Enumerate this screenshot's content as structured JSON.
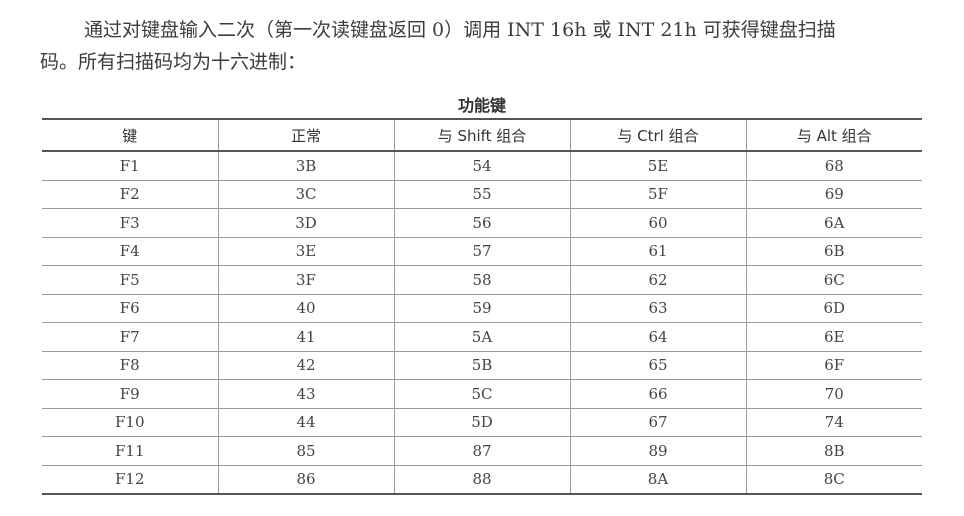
{
  "intro": {
    "line1": "通过对键盘输入二次（第一次读键盘返回 0）调用 INT 16h 或 INT 21h 可获得键盘扫描",
    "line2": "码。所有扫描码均为十六进制："
  },
  "table": {
    "title": "功能键",
    "headers": [
      "键",
      "正常",
      "与 Shift 组合",
      "与 Ctrl 组合",
      "与 Alt 组合"
    ],
    "rows": [
      [
        "F1",
        "3B",
        "54",
        "5E",
        "68"
      ],
      [
        "F2",
        "3C",
        "55",
        "5F",
        "69"
      ],
      [
        "F3",
        "3D",
        "56",
        "60",
        "6A"
      ],
      [
        "F4",
        "3E",
        "57",
        "61",
        "6B"
      ],
      [
        "F5",
        "3F",
        "58",
        "62",
        "6C"
      ],
      [
        "F6",
        "40",
        "59",
        "63",
        "6D"
      ],
      [
        "F7",
        "41",
        "5A",
        "64",
        "6E"
      ],
      [
        "F8",
        "42",
        "5B",
        "65",
        "6F"
      ],
      [
        "F9",
        "43",
        "5C",
        "66",
        "70"
      ],
      [
        "F10",
        "44",
        "5D",
        "67",
        "74"
      ],
      [
        "F11",
        "85",
        "87",
        "89",
        "8B"
      ],
      [
        "F12",
        "86",
        "88",
        "8A",
        "8C"
      ]
    ]
  }
}
